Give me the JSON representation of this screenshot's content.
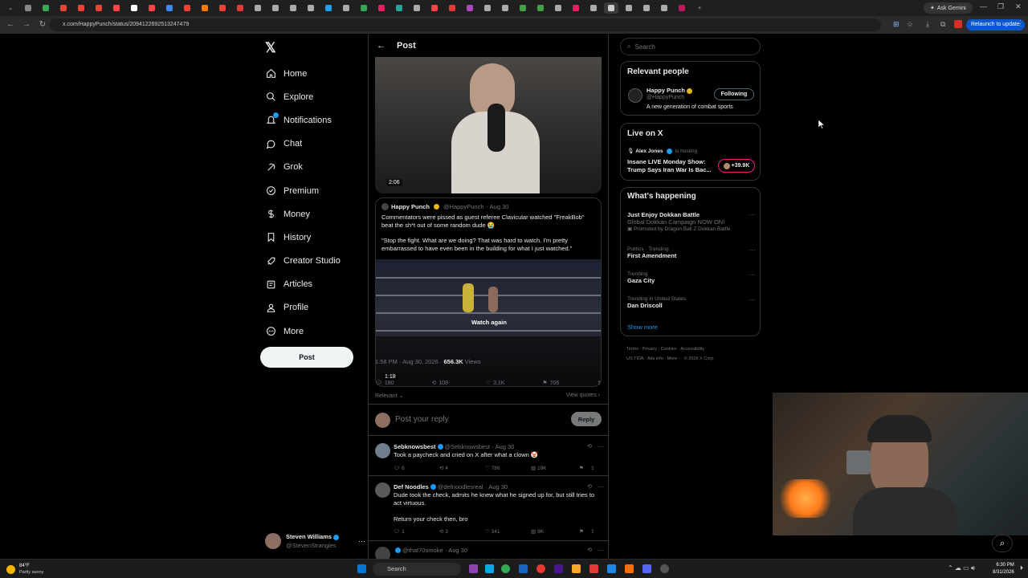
{
  "browser": {
    "url": "x.com/HappyPunch/status/2094122692513247479",
    "ask_gemini": "Ask Gemini",
    "relaunch": "Relaunch to update"
  },
  "nav": {
    "items": [
      {
        "label": "Home",
        "icon": "home-icon"
      },
      {
        "label": "Explore",
        "icon": "search-icon"
      },
      {
        "label": "Notifications",
        "icon": "bell-icon"
      },
      {
        "label": "Chat",
        "icon": "chat-icon"
      },
      {
        "label": "Grok",
        "icon": "grok-icon"
      },
      {
        "label": "Premium",
        "icon": "premium-icon"
      },
      {
        "label": "Money",
        "icon": "money-icon"
      },
      {
        "label": "History",
        "icon": "history-icon"
      },
      {
        "label": "Creator Studio",
        "icon": "rocket-icon"
      },
      {
        "label": "Articles",
        "icon": "articles-icon"
      },
      {
        "label": "Profile",
        "icon": "profile-icon"
      },
      {
        "label": "More",
        "icon": "more-icon"
      }
    ],
    "post_button": "Post",
    "account": {
      "name": "Steven Williams",
      "handle": "@StevenStrangles"
    }
  },
  "post": {
    "header": "Post",
    "video1_time": "2:06",
    "quote": {
      "name": "Happy Punch",
      "handle": "@HappyPunch",
      "date": "· Aug 30",
      "text1": "Commentators were pissed as guest referee Clavicular watched \"FreakBob\" beat the sh*t out of some random dude 😭",
      "text2": "\"Stop the fight. What are we doing? That was hard to watch. I'm pretty embarrassed to have even been in the building for what I just watched.\"",
      "watch_again": "Watch again",
      "video2_time": "1:18"
    },
    "time": "1:58 PM · Aug 30, 2026 ·",
    "views_count": "656.3K",
    "views_label": "Views",
    "replies": "180",
    "reposts": "108",
    "likes": "3.1K",
    "bookmarks": "706",
    "relevant": "Relevant",
    "view_quotes": "View quotes",
    "reply_placeholder": "Post your reply",
    "reply_button": "Reply"
  },
  "replies": [
    {
      "name": "Sebknowsbest",
      "handle": "@Sebknowsbest",
      "date": "· Aug 30",
      "text": "Took a paycheck and cried on X after what a clown 🤡",
      "replies": "6",
      "reposts": "4",
      "likes": "786",
      "views": "19K"
    },
    {
      "name": "Def Noodles",
      "handle": "@defnoodlesreal",
      "date": "· Aug 30",
      "text": "Dude took the check, admits he knew what he signed up for, but still tries to act virtuous.",
      "text2": "Return your check then, bro",
      "replies": "1",
      "reposts": "3",
      "likes": "341",
      "views": "9K"
    },
    {
      "handle": "@that70smoke",
      "date": "· Aug 30"
    }
  ],
  "sidebar": {
    "search_placeholder": "Search",
    "relevant_people": {
      "title": "Relevant people",
      "name": "Happy Punch",
      "handle": "@HappyPunch",
      "bio": "A new generation of combat sports",
      "follow_label": "Following"
    },
    "live": {
      "title": "Live on X",
      "host": "Alex Jones",
      "hosting": "is hosting",
      "title_text": "Insane LIVE Monday Show: Trump Says Iran War Is Bac...",
      "count": "+39.9K"
    },
    "happening": {
      "title": "What's happening",
      "trends": [
        {
          "meta": "Just Enjoy Dokkan Battle",
          "title": "Global Dokkan Campaign NOW ON!",
          "promo": "Promoted by Dragon Ball Z Dokkan Battle"
        },
        {
          "meta": "Politics · Trending",
          "title": "First Amendment"
        },
        {
          "meta": "Trending",
          "title": "Gaza City"
        },
        {
          "meta": "Trending in United States",
          "title": "Dan Driscoll"
        }
      ],
      "show_more": "Show more"
    },
    "footer": {
      "line1": "Terms  ·  Privacy  ·  Cookies  ·  Accessibility",
      "line2": "US TIDA  ·  Ads info  ·  More ···  © 2026 X Corp."
    }
  },
  "taskbar": {
    "weather_temp": "84°F",
    "weather_desc": "Partly sunny",
    "search": "Search",
    "time": "6:30 PM",
    "date": "8/31/2026"
  }
}
